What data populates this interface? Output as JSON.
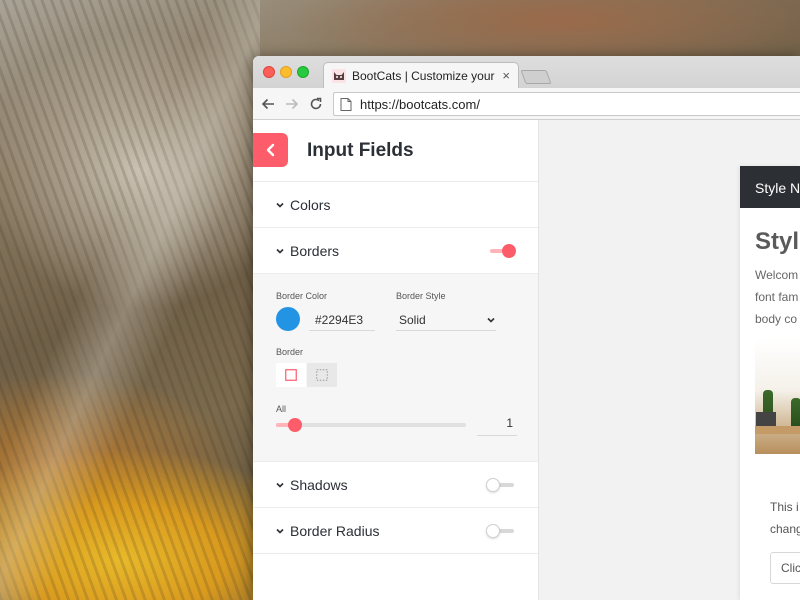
{
  "browser": {
    "tab_title": "BootCats | Customize your Bootstrap",
    "tab_close": "×",
    "url": "https://bootcats.com/"
  },
  "panel": {
    "title": "Input Fields",
    "sections": {
      "colors": {
        "label": "Colors"
      },
      "borders": {
        "label": "Borders",
        "enabled": true,
        "border_color_label": "Border Color",
        "border_color_value": "#2294E3",
        "border_style_label": "Border Style",
        "border_style_value": "Solid",
        "border_label": "Border",
        "all_label": "All",
        "all_value": "1",
        "all_slider_fraction": 0.1
      },
      "shadows": {
        "label": "Shadows",
        "enabled": false
      },
      "border_radius": {
        "label": "Border Radius",
        "enabled": false
      }
    }
  },
  "preview": {
    "nav_text": "Style N",
    "title": "Styl",
    "intro_lines": [
      "Welcom",
      "font fam",
      "body co"
    ],
    "card_lines": [
      "This i",
      "chang"
    ],
    "button_label": "Clic"
  },
  "colors": {
    "accent": "#fd5d6a",
    "border_color": "#2294e3"
  }
}
